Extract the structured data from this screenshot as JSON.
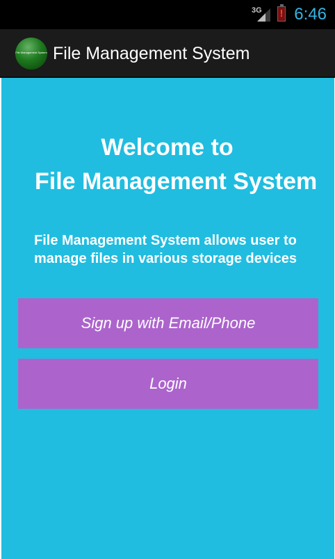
{
  "status_bar": {
    "network_type": "3G",
    "time": "6:46",
    "battery_alert": "!"
  },
  "app_bar": {
    "logo_text": "File Management System",
    "title": "File Management System"
  },
  "main": {
    "welcome_line1": "Welcome to",
    "welcome_line2": "File Management System",
    "description": "File Management System allows user to manage files in various storage devices",
    "signup_button": "Sign up with Email/Phone",
    "login_button": "Login"
  },
  "colors": {
    "content_background": "#20bde0",
    "button_background": "#ac64cc",
    "clock": "#33b5e5"
  }
}
